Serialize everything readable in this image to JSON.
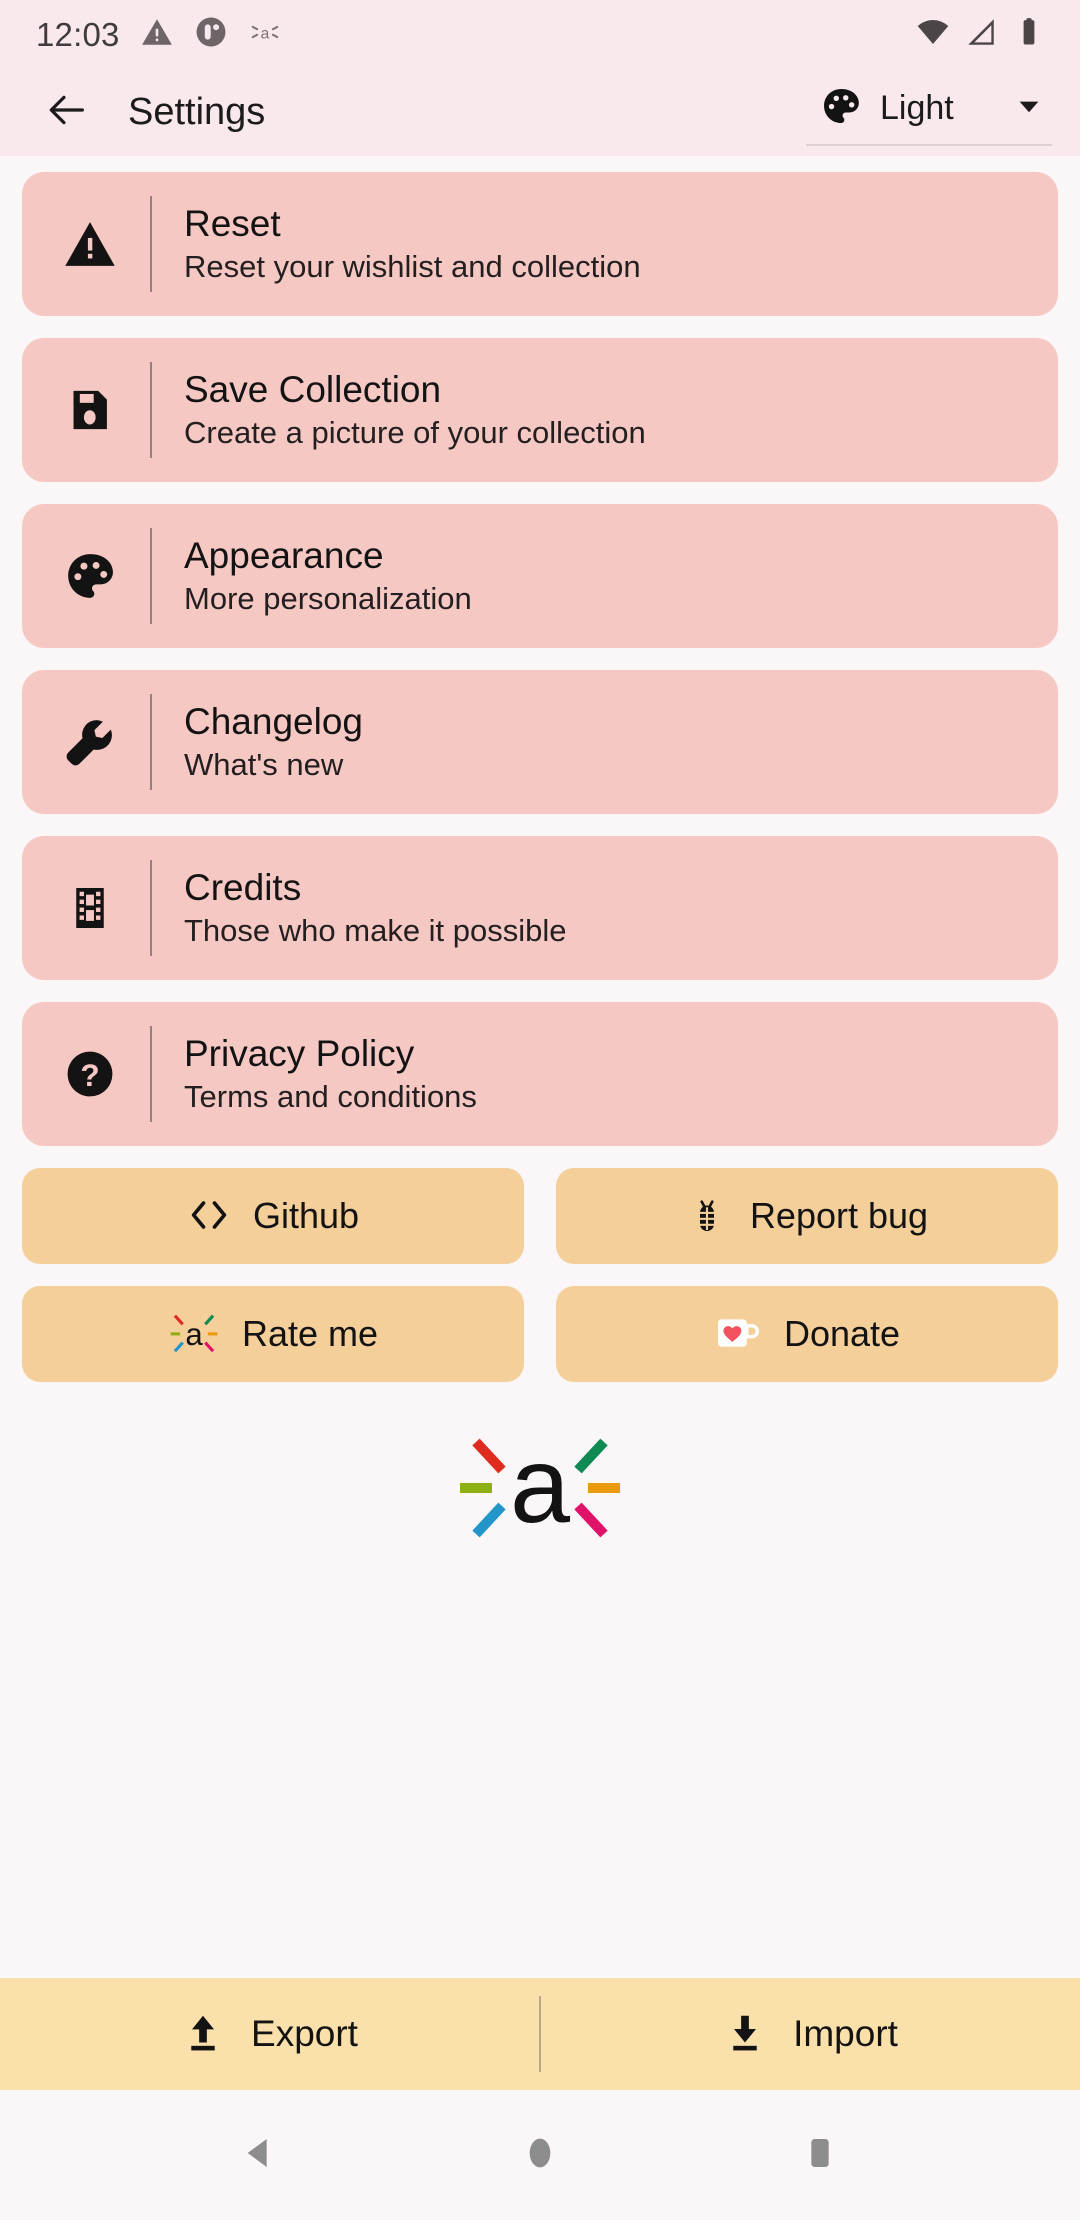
{
  "status_bar": {
    "time": "12:03",
    "left_icons": [
      "warning-triangle-icon",
      "app-notification-icon",
      "vibrate-icon"
    ],
    "right_icons": [
      "wifi-icon",
      "cellular-signal-icon",
      "battery-icon"
    ]
  },
  "app_bar": {
    "back_icon": "back-arrow-icon",
    "title": "Settings",
    "theme": {
      "icon": "palette-icon",
      "value": "Light",
      "chevron": "chevron-down-icon"
    }
  },
  "settings": [
    {
      "icon": "warning-triangle-icon",
      "title": "Reset",
      "subtitle": "Reset your wishlist and collection"
    },
    {
      "icon": "floppy-disk-icon",
      "title": "Save Collection",
      "subtitle": "Create a picture of your collection"
    },
    {
      "icon": "palette-icon",
      "title": "Appearance",
      "subtitle": "More personalization"
    },
    {
      "icon": "wrench-icon",
      "title": "Changelog",
      "subtitle": "What's new"
    },
    {
      "icon": "film-strip-icon",
      "title": "Credits",
      "subtitle": "Those who make it possible"
    },
    {
      "icon": "help-question-icon",
      "title": "Privacy Policy",
      "subtitle": "Terms and conditions"
    }
  ],
  "actions": [
    {
      "icon": "code-brackets-icon",
      "label": "Github"
    },
    {
      "icon": "bug-icon",
      "label": "Report bug"
    },
    {
      "icon": "app-logo-icon",
      "label": "Rate me"
    },
    {
      "icon": "coffee-heart-icon",
      "label": "Donate"
    }
  ],
  "logo": {
    "name": "app-logo",
    "letter": "a",
    "ray_colors": [
      "#e02b20",
      "#0e8a52",
      "#8fae13",
      "#eb9a10",
      "#2295c9",
      "#e0136b"
    ]
  },
  "bottom_bar": [
    {
      "icon": "upload-icon",
      "label": "Export"
    },
    {
      "icon": "download-icon",
      "label": "Import"
    }
  ],
  "nav_bar": {
    "back": "nav-back-icon",
    "home": "nav-home-icon",
    "recents": "nav-recents-icon"
  },
  "colors": {
    "header_bg": "#f9e9ec",
    "page_bg": "#fbf7f8",
    "card_bg": "#f6c8c3",
    "action_bg": "#f5cf9a",
    "bottom_bg": "#fae0ab",
    "text": "#141313"
  }
}
